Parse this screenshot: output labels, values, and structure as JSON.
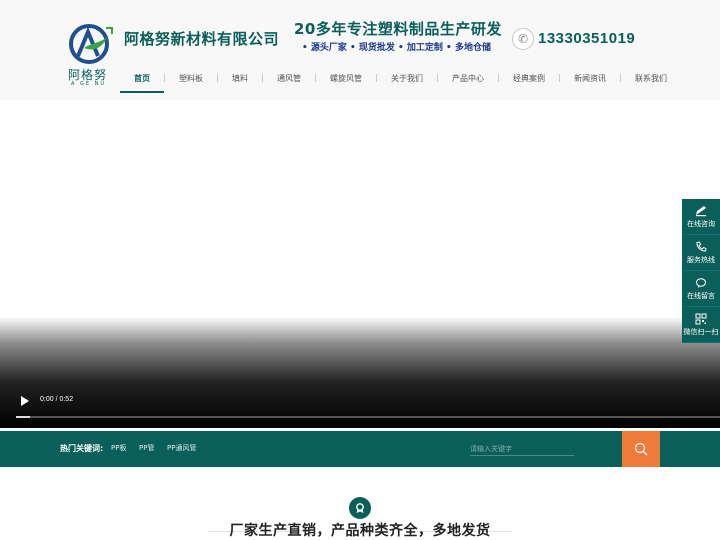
{
  "header": {
    "logo_cn": "阿格努",
    "logo_en": "A GE NU",
    "company": "阿格努新材料有限公司",
    "slogan_main": "20多年专注塑料制品生产研发",
    "slogan_sub": "• 源头厂家 • 现货批发 • 加工定制 • 多地仓储",
    "phone": "13330351019",
    "phone_icon": "phone-icon"
  },
  "nav": {
    "items": [
      {
        "label": "首页",
        "active": true
      },
      {
        "label": "塑料板"
      },
      {
        "label": "填料"
      },
      {
        "label": "通风管"
      },
      {
        "label": "螺旋风管"
      },
      {
        "label": "关于我们"
      },
      {
        "label": "产品中心"
      },
      {
        "label": "经典案例"
      },
      {
        "label": "新闻资讯"
      },
      {
        "label": "联系我们"
      }
    ]
  },
  "video": {
    "time": "0:00 / 0:52",
    "progress": 0.02,
    "play_icon": "play-icon"
  },
  "search": {
    "hot_label": "热门关键词:",
    "keywords": [
      "PP板",
      "PP管",
      "PP通风管"
    ],
    "placeholder": "请输入关键字",
    "button_icon": "search-icon"
  },
  "section": {
    "title": "厂家生产直销，产品种类齐全，多地发货",
    "icon": "badge-icon"
  },
  "float_bar": {
    "items": [
      {
        "label": "在线咨询",
        "icon": "chat-icon"
      },
      {
        "label": "服务热线",
        "icon": "phone-icon"
      },
      {
        "label": "在线留言",
        "icon": "message-icon"
      },
      {
        "label": "微信扫一扫",
        "icon": "qrcode-icon"
      }
    ]
  },
  "colors": {
    "brand": "#0b5f5a",
    "accent": "#f07a3a"
  }
}
